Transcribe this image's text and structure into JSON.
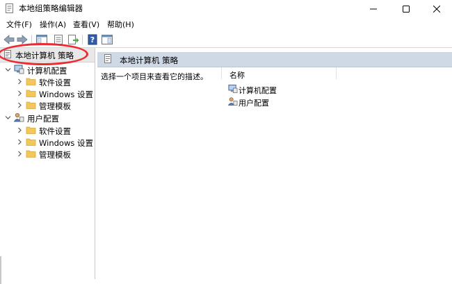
{
  "window": {
    "title": "本地组策略编辑器"
  },
  "menu": {
    "items": [
      "文件(F)",
      "操作(A)",
      "查看(V)",
      "帮助(H)"
    ]
  },
  "toolbar": {
    "icons": [
      "back-arrow-icon",
      "forward-arrow-icon",
      "show-hide-tree-icon",
      "properties-icon",
      "export-list-icon",
      "help-icon",
      "show-hide-action-pane-icon"
    ]
  },
  "tree": {
    "root_label": "本地计算机 策略",
    "computer": {
      "label": "计算机配置",
      "children": [
        "软件设置",
        "Windows 设置",
        "管理模板"
      ]
    },
    "user": {
      "label": "用户配置",
      "children": [
        "软件设置",
        "Windows 设置",
        "管理模板"
      ]
    }
  },
  "details": {
    "header": "本地计算机 策略",
    "description": "选择一个项目来查看它的描述。",
    "column_name": "名称",
    "items": [
      "计算机配置",
      "用户配置"
    ]
  },
  "colors": {
    "annotation_ring": "#ec2a32",
    "header_band": "#cfd9e6",
    "folder": "#f2c75c"
  }
}
